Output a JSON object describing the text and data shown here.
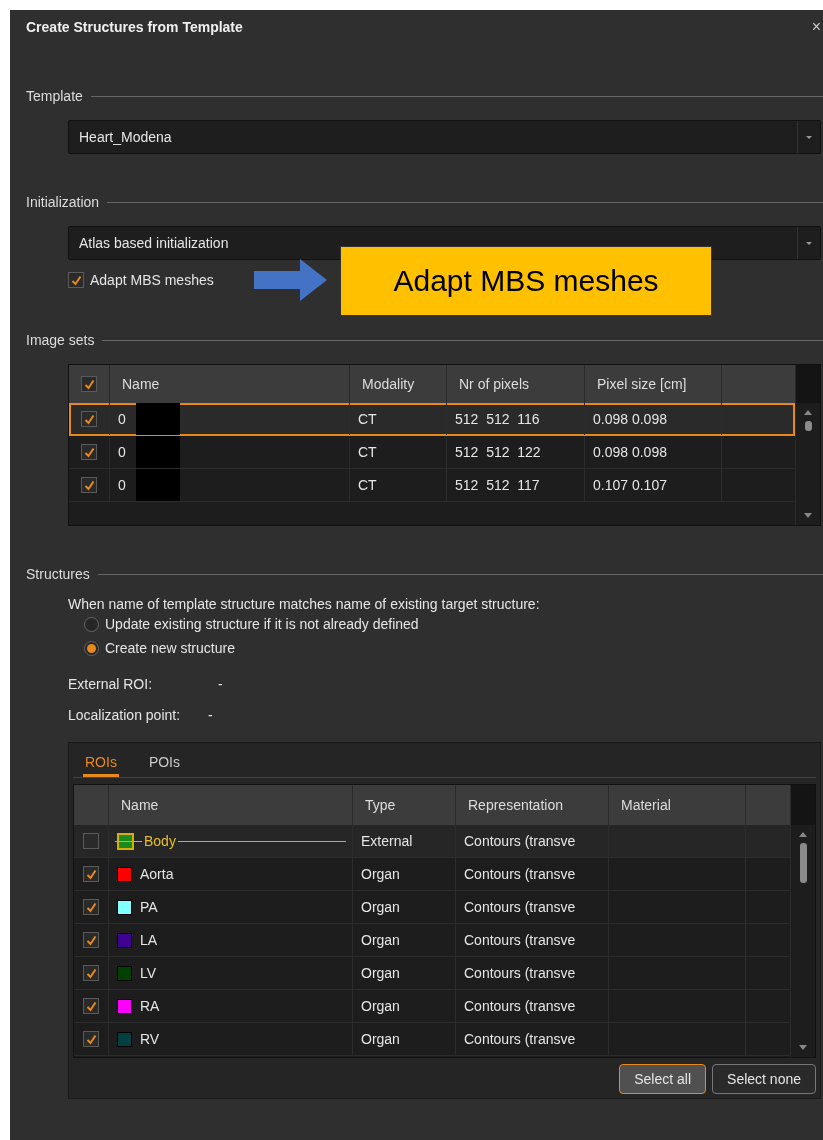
{
  "dialog": {
    "title": "Create Structures from Template",
    "close": "×"
  },
  "template": {
    "label": "Template",
    "value": "Heart_Modena"
  },
  "initialization": {
    "label": "Initialization",
    "value": "Atlas based initialization",
    "adapt_mbs": {
      "label": "Adapt MBS meshes",
      "checked": true
    },
    "callout": "Adapt MBS meshes"
  },
  "image_sets": {
    "label": "Image sets",
    "all_checked": true,
    "columns": [
      "Name",
      "Modality",
      "Nr of pixels",
      "Pixel size [cm]"
    ],
    "rows": [
      {
        "name": "0",
        "modality": "CT",
        "pixels": "512  512  116",
        "pixel_size": "0.098 0.098",
        "checked": true,
        "selected": true,
        "redacted": true
      },
      {
        "name": "0",
        "modality": "CT",
        "pixels": "512  512  122",
        "pixel_size": "0.098 0.098",
        "checked": true,
        "selected": false,
        "redacted": true
      },
      {
        "name": "0",
        "modality": "CT",
        "pixels": "512  512  117",
        "pixel_size": "0.107 0.107",
        "checked": true,
        "selected": false,
        "redacted": true
      }
    ]
  },
  "structures": {
    "label": "Structures",
    "question": "When name of template structure matches name of existing target structure:",
    "options": [
      {
        "label": "Update existing structure if it is not already defined",
        "selected": false
      },
      {
        "label": "Create new structure",
        "selected": true
      }
    ],
    "external_roi": {
      "label": "External ROI:",
      "value": "-"
    },
    "localization_point": {
      "label": "Localization point:",
      "value": "-"
    },
    "tabs": [
      {
        "label": "ROIs",
        "selected": true
      },
      {
        "label": "POIs",
        "selected": false
      }
    ],
    "columns": [
      "Name",
      "Type",
      "Representation",
      "Material"
    ],
    "rows": [
      {
        "name": "Body",
        "color": "#1a8a1a",
        "type": "External",
        "representation": "Contours (transve",
        "checked": false,
        "selected": true,
        "struck": true
      },
      {
        "name": "Aorta",
        "color": "#ff0000",
        "type": "Organ",
        "representation": "Contours (transve",
        "checked": true,
        "selected": false,
        "struck": false
      },
      {
        "name": "PA",
        "color": "#80ffff",
        "type": "Organ",
        "representation": "Contours (transve",
        "checked": true,
        "selected": false,
        "struck": false
      },
      {
        "name": "LA",
        "color": "#400090",
        "type": "Organ",
        "representation": "Contours (transve",
        "checked": true,
        "selected": false,
        "struck": false
      },
      {
        "name": "LV",
        "color": "#004000",
        "type": "Organ",
        "representation": "Contours (transve",
        "checked": true,
        "selected": false,
        "struck": false
      },
      {
        "name": "RA",
        "color": "#ff00ff",
        "type": "Organ",
        "representation": "Contours (transve",
        "checked": true,
        "selected": false,
        "struck": false
      },
      {
        "name": "RV",
        "color": "#004040",
        "type": "Organ",
        "representation": "Contours (transve",
        "checked": true,
        "selected": false,
        "struck": false
      }
    ],
    "buttons": [
      {
        "label": "Select all",
        "selected": true
      },
      {
        "label": "Select none",
        "selected": false
      }
    ]
  }
}
